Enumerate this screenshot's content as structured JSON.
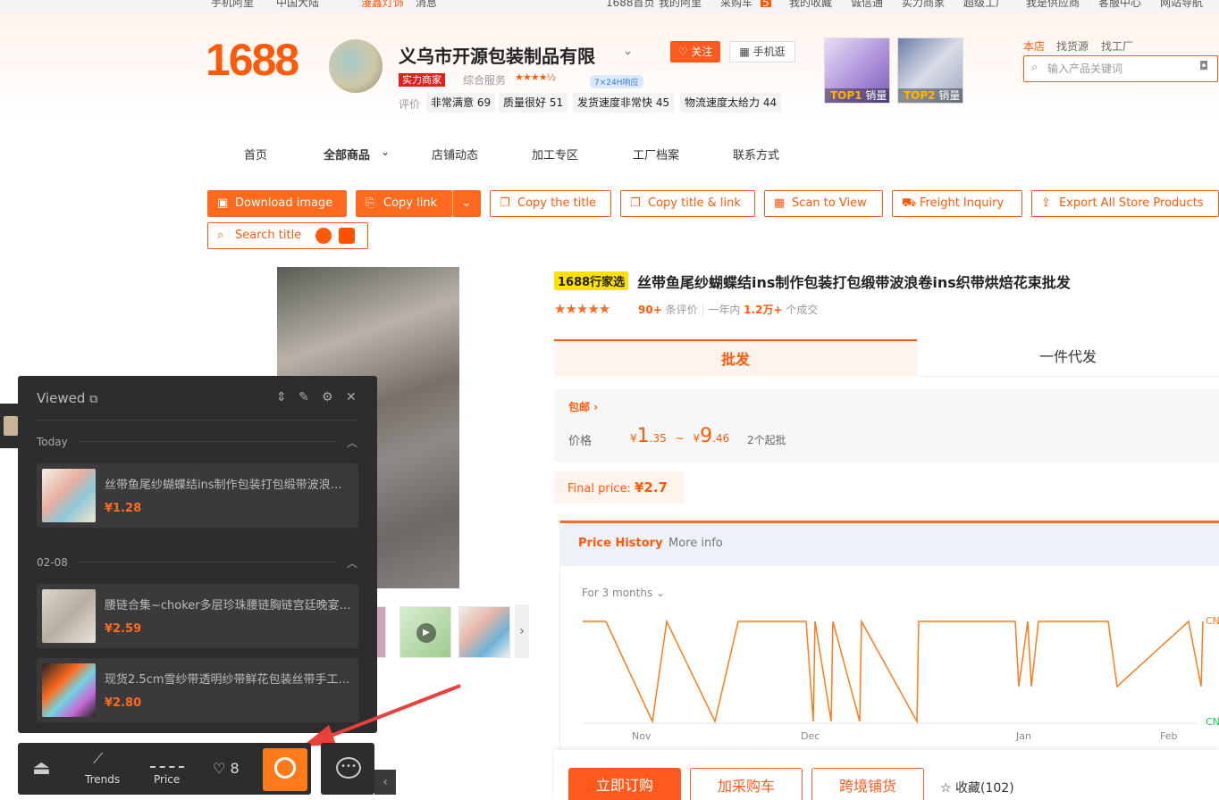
{
  "topbar": {
    "left": [
      "手机阿里",
      "中国大陆",
      "漫鑫灯饰",
      "消息"
    ],
    "right": [
      "1688首页",
      "我的阿里",
      "采购车",
      "5",
      "我的收藏",
      "诚信通",
      "实力商家",
      "超级工厂",
      "我是供应商",
      "客服中心",
      "网站导航"
    ]
  },
  "header": {
    "logo": "1688",
    "shop_name": "义乌市开源包装制品有限",
    "follow": "关注",
    "mobile": "手机逛",
    "badge": "实力商家",
    "service_label": "综合服务",
    "service_stars": "★★★★½",
    "response": "7×24H响应",
    "eval_label": "评价",
    "eval_tags": [
      "非常满意 69",
      "质量很好 51",
      "发货速度非常快 45",
      "物流速度太给力 44"
    ],
    "top_items": [
      {
        "rank": "TOP1",
        "label": "销量"
      },
      {
        "rank": "TOP2",
        "label": "销量"
      }
    ],
    "search_tabs": [
      "本店",
      "找货源",
      "找工厂"
    ],
    "search_placeholder": "输入产品关键词"
  },
  "nav": [
    "首页",
    "全部商品",
    "店铺动态",
    "加工专区",
    "工厂档案",
    "联系方式"
  ],
  "actions": [
    "Download image",
    "Copy link",
    "Copy the title",
    "Copy title & link",
    "Scan to View",
    "Freight Inquiry",
    "Export All Store Products",
    "Search title"
  ],
  "product": {
    "badge": "1688行家选",
    "title": "丝带鱼尾纱蝴蝶结ins制作包装打包缎带波浪卷ins织带烘焙花束批发",
    "stars": "★★★★★",
    "review_count": "90+",
    "review_label": "条评价",
    "year_label": "一年内",
    "deals": "1.2万+",
    "deals_label": "个成交",
    "tab_wholesale": "批发",
    "tab_dropship": "一件代发",
    "free_shipping": "包邮",
    "price_label": "价格",
    "price_low_int": "1",
    "price_low_dec": ".35",
    "price_sep": "~",
    "price_high_int": "9",
    "price_high_dec": ".46",
    "currency": "¥",
    "min_order": "2个起批",
    "final_label": "Final price:",
    "final_value": "¥2.7"
  },
  "price_history": {
    "tab_active": "Price History",
    "tab_other": "More info",
    "range": "For 3 months",
    "right_label": "CN"
  },
  "chart_data": {
    "type": "line",
    "title": "Price History",
    "x_ticks": [
      "Nov",
      "Dec",
      "Jan",
      "Feb"
    ],
    "series": [
      {
        "values": [
          1,
          1,
          0,
          1,
          0,
          1,
          1,
          0,
          1,
          0,
          1,
          0,
          1,
          0,
          1,
          1,
          0.35,
          1,
          0.35,
          1,
          1,
          0.35,
          1,
          0.35,
          1
        ]
      }
    ],
    "ylim": [
      0,
      1
    ],
    "grid": false
  },
  "order": {
    "buy_now": "立即订购",
    "add_cart": "加采购车",
    "cross_border": "跨境铺货",
    "favorite": "收藏(102)"
  },
  "viewed": {
    "title": "Viewed",
    "sections": [
      {
        "label": "Today",
        "items": [
          {
            "title": "丝带鱼尾纱蝴蝶结ins制作包装打包缎带波浪卷...",
            "price": "¥1.28"
          }
        ]
      },
      {
        "label": "02-08",
        "items": [
          {
            "title": "腰链合集~choker多层珍珠腰链胸链宫廷晚宴肩...",
            "price": "¥2.59"
          },
          {
            "title": "现货2.5cm雪纱带透明纱带鲜花包装丝带手工di...",
            "price": "¥2.80"
          }
        ]
      }
    ]
  },
  "toolbar": {
    "trends": "Trends",
    "price": "Price",
    "fav_count": "8"
  }
}
